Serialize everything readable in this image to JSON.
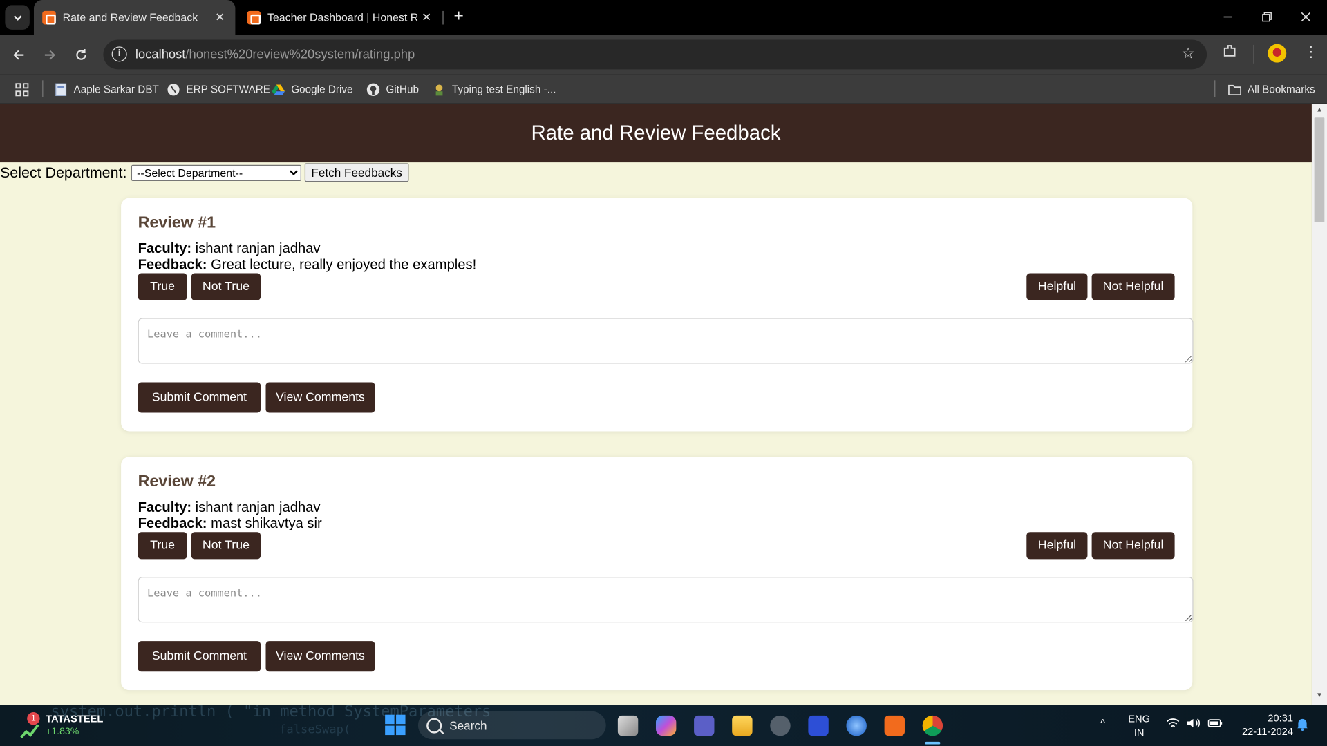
{
  "browser": {
    "tabs": [
      {
        "title": "Rate and Review Feedback",
        "active": true
      },
      {
        "title": "Teacher Dashboard | Honest Re",
        "active": false
      }
    ],
    "url_host": "localhost",
    "url_path": "/honest%20review%20system/rating.php",
    "bookmarks": [
      {
        "label": "Aaple Sarkar DBT",
        "icon": "page-icon"
      },
      {
        "label": "ERP SOFTWARE",
        "icon": "globe-icon"
      },
      {
        "label": "Google Drive",
        "icon": "google-drive-icon"
      },
      {
        "label": "GitHub",
        "icon": "github-icon"
      },
      {
        "label": "Typing test English -...",
        "icon": "typing-icon"
      }
    ],
    "all_bookmarks_label": "All Bookmarks"
  },
  "page": {
    "header_title": "Rate and Review Feedback",
    "department_label": "Select Department:",
    "department_selected": "--Select Department--",
    "fetch_button": "Fetch Feedbacks",
    "reviews": [
      {
        "title": "Review #1",
        "faculty_label": "Faculty:",
        "faculty": "ishant ranjan jadhav",
        "feedback_label": "Feedback:",
        "feedback": "Great lecture, really enjoyed the examples!"
      },
      {
        "title": "Review #2",
        "faculty_label": "Faculty:",
        "faculty": "ishant ranjan jadhav",
        "feedback_label": "Feedback:",
        "feedback": "mast shikavtya sir"
      }
    ],
    "buttons": {
      "true": "True",
      "not_true": "Not True",
      "helpful": "Helpful",
      "not_helpful": "Not Helpful",
      "submit_comment": "Submit Comment",
      "view_comments": "View Comments"
    },
    "comment_placeholder": "Leave a comment..."
  },
  "taskbar": {
    "stock_badge": "1",
    "stock_name": "TATASTEEL",
    "stock_change": "+1.83%",
    "search_label": "Search",
    "lang_top": "ENG",
    "lang_bottom": "IN",
    "time": "20:31",
    "date": "22-11-2024"
  },
  "colors": {
    "header_bg": "#3b2620",
    "page_bg": "#f5f5dc",
    "button_bg": "#3b2620"
  }
}
